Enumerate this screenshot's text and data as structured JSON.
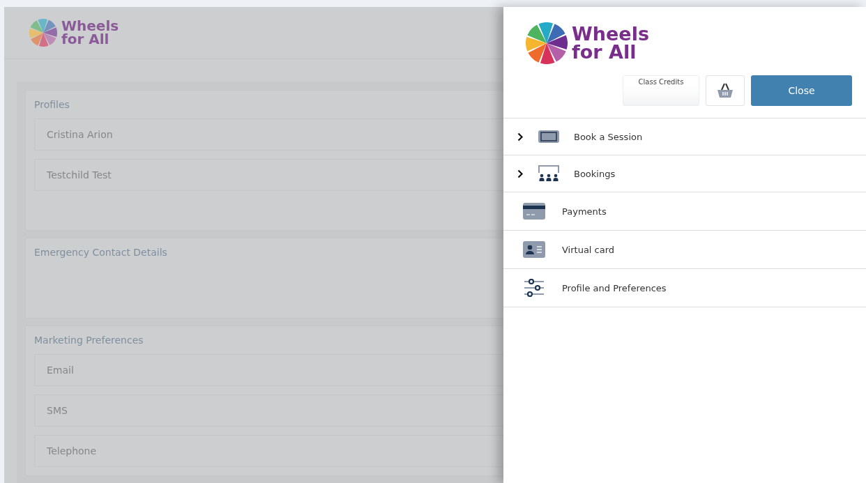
{
  "background_page": {
    "logo": {
      "line1": "Wheels",
      "line2": "for All"
    },
    "sections": [
      {
        "title": "Profiles",
        "items": [
          "Cristina Arion",
          "Testchild Test"
        ]
      },
      {
        "title": "Emergency Contact Details"
      },
      {
        "title": "Marketing Preferences",
        "items": [
          "Email",
          "SMS",
          "Telephone"
        ]
      }
    ]
  },
  "drawer": {
    "logo": {
      "line1": "Wheels",
      "line2": "for All"
    },
    "credits": {
      "label": "Class Credits"
    },
    "close_button": "Close",
    "menu": [
      {
        "label": "Book a Session",
        "kind": "ticket",
        "expandable": true
      },
      {
        "label": "Bookings",
        "kind": "audience",
        "expandable": true
      },
      {
        "label": "Payments",
        "kind": "card",
        "expandable": false
      },
      {
        "label": "Virtual card",
        "kind": "idcard",
        "expandable": false
      },
      {
        "label": "Profile and Preferences",
        "kind": "sliders",
        "expandable": false
      }
    ]
  }
}
